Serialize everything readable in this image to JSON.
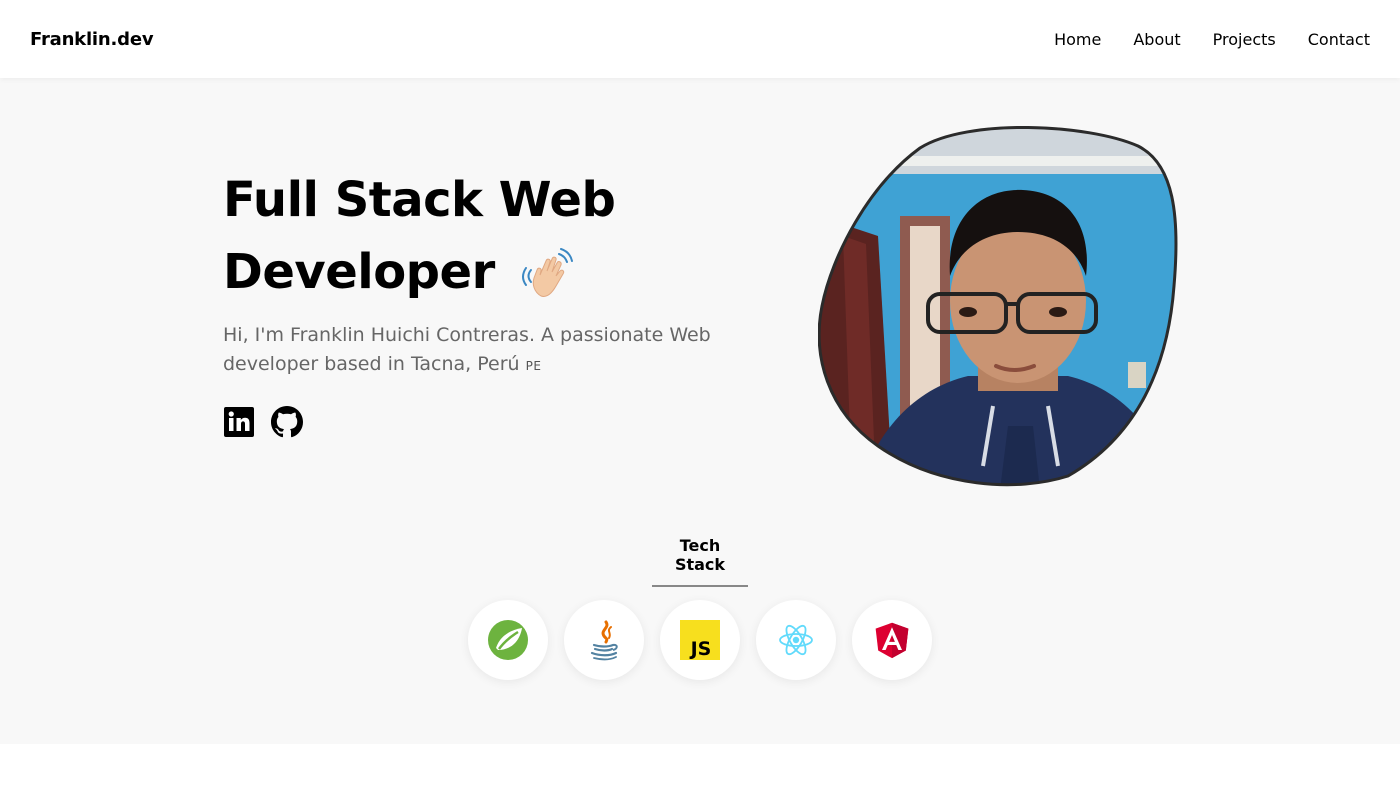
{
  "nav": {
    "brand": "Franklin.dev",
    "links": [
      {
        "label": "Home"
      },
      {
        "label": "About"
      },
      {
        "label": "Projects"
      },
      {
        "label": "Contact"
      }
    ]
  },
  "hero": {
    "title_line1": "Full Stack Web",
    "title_line2": "Developer",
    "wave_icon": "waving-hand-icon",
    "description": "Hi, I'm Franklin Huichi Contreras. A passionate Web developer based in Tacna, Perú",
    "flag": "PE",
    "socials": [
      {
        "name": "linkedin-icon"
      },
      {
        "name": "github-icon"
      }
    ],
    "photo": "profile-photo"
  },
  "tech_stack": {
    "title": "Tech Stack",
    "items": [
      {
        "name": "spring-icon",
        "color": "#6db33f"
      },
      {
        "name": "java-icon",
        "color": "#e76f00"
      },
      {
        "name": "javascript-icon",
        "label": "JS",
        "color": "#f7df1e"
      },
      {
        "name": "react-icon",
        "color": "#61dafb"
      },
      {
        "name": "angular-icon",
        "color": "#dd0031"
      }
    ]
  },
  "colors": {
    "hero_bg": "#f8f8f8",
    "text": "#000000",
    "muted": "#666666"
  }
}
